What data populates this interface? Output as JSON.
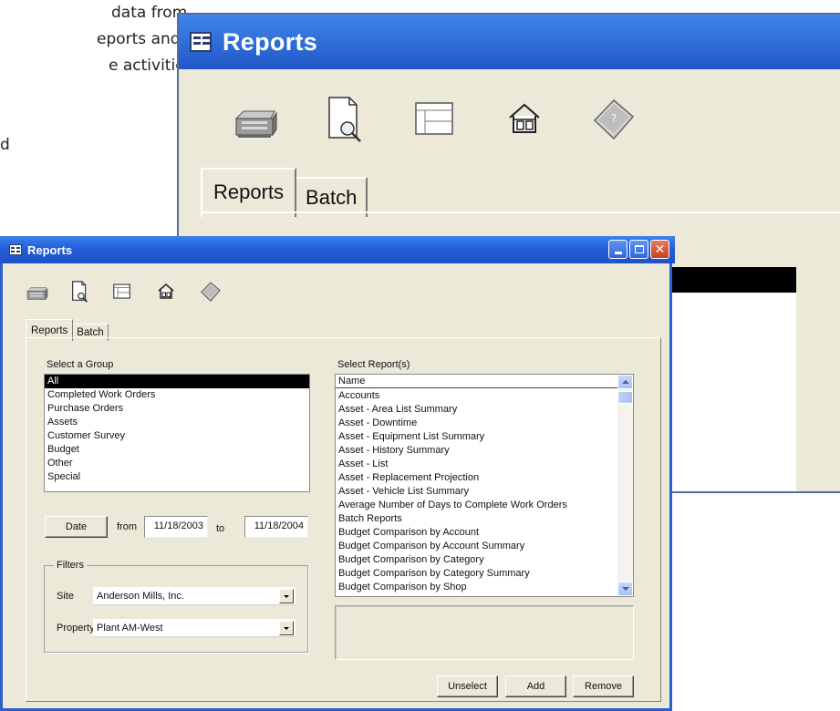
{
  "background_text": {
    "line1": "data from",
    "line2": "eports and",
    "line3": "e activities",
    "line4": "d"
  },
  "back_window": {
    "title": "Reports",
    "toolbar_icons": [
      "print-icon",
      "print-preview-icon",
      "layout-icon",
      "home-icon",
      "help-book-icon"
    ],
    "tabs": [
      "Reports",
      "Batch"
    ]
  },
  "front_window": {
    "title": "Reports",
    "toolbar_icons": [
      "print-icon",
      "print-preview-icon",
      "layout-icon",
      "home-icon",
      "help-book-icon"
    ],
    "tabs": [
      "Reports",
      "Batch"
    ],
    "select_group_label": "Select a Group",
    "groups": [
      "All",
      "Completed Work Orders",
      "Purchase Orders",
      "Assets",
      "Customer Survey",
      "Budget",
      "Other",
      "Special"
    ],
    "select_reports_label": "Select Report(s)",
    "reports_header": "Name",
    "reports": [
      "Accounts",
      "Asset - Area List Summary",
      "Asset - Downtime",
      "Asset - Equipment List Summary",
      "Asset - History Summary",
      "Asset - List",
      "Asset - Replacement Projection",
      "Asset - Vehicle List Summary",
      "Average Number of Days to Complete Work Orders",
      "Batch Reports",
      "Budget Comparison by Account",
      "Budget Comparison by Account Summary",
      "Budget Comparison by Category",
      "Budget Comparison by Category Summary",
      "Budget Comparison by Shop"
    ],
    "date_button": "Date",
    "from_label": "from",
    "from_date": "11/18/2003",
    "to_label": "to",
    "to_date": "11/18/2004",
    "filters_label": "Filters",
    "site_label": "Site",
    "site_value": "Anderson Mills, Inc.",
    "property_label": "Property",
    "property_value": "Plant AM-West",
    "buttons": {
      "unselect": "Unselect",
      "add": "Add",
      "remove": "Remove"
    },
    "colors": {
      "titlebar": "#245ed8",
      "selection": "#000000",
      "face": "#ece9d8"
    }
  }
}
